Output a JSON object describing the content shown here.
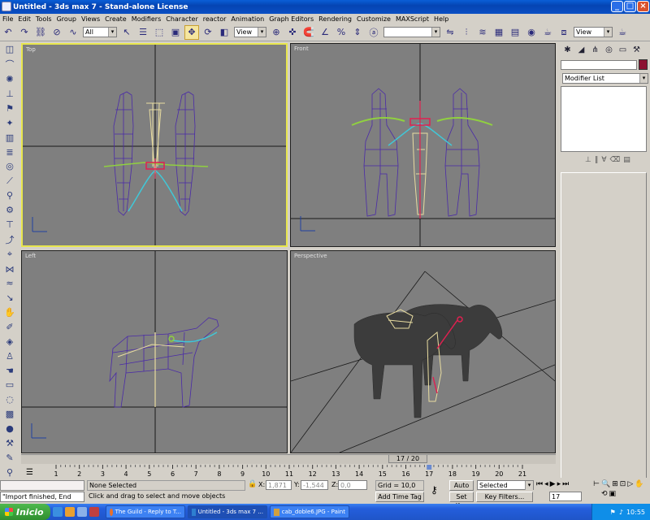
{
  "window": {
    "title": "Untitled - 3ds max 7 - Stand-alone License",
    "controls": {
      "minimize": "_",
      "maximize": "□",
      "close": "×"
    }
  },
  "menu": [
    "File",
    "Edit",
    "Tools",
    "Group",
    "Views",
    "Create",
    "Modifiers",
    "Character",
    "reactor",
    "Animation",
    "Graph Editors",
    "Rendering",
    "Customize",
    "MAXScript",
    "Help"
  ],
  "toolbar": {
    "selection_filter": "All",
    "ref_coord": "View",
    "named_selection": "",
    "view_dropdown": "View"
  },
  "viewports": {
    "top": "Top",
    "front": "Front",
    "left": "Left",
    "perspective": "Perspective"
  },
  "command_panel": {
    "name_field": "",
    "modifier_list": "Modifier List",
    "color": "#8b1030"
  },
  "timeline": {
    "slider": "17 / 20",
    "ticks": [
      "1",
      "2",
      "3",
      "4",
      "5",
      "6",
      "7",
      "8",
      "9",
      "10",
      "11",
      "12",
      "13",
      "14",
      "15",
      "16",
      "17",
      "18",
      "19",
      "20",
      "21"
    ]
  },
  "status": {
    "listener": "\"Import finished, End",
    "selection": "None Selected",
    "prompt": "Click and drag to select and move objects",
    "x_label": "X:",
    "x_value": "1,871",
    "y_label": "Y:",
    "y_value": "-1,544",
    "z_label": "Z:",
    "z_value": "0,0",
    "grid": "Grid = 10,0",
    "add_time_tag": "Add Time Tag",
    "auto_key": "Auto Key",
    "set_key": "Set Key",
    "selected": "Selected",
    "key_filters": "Key Filters...",
    "frame": "17"
  },
  "taskbar": {
    "start": "Inicio",
    "tasks": [
      "The Guild - Reply to T...",
      "Untitled - 3ds max 7 ...",
      "cab_doble6.JPG - Paint"
    ],
    "clock": "10:55"
  }
}
